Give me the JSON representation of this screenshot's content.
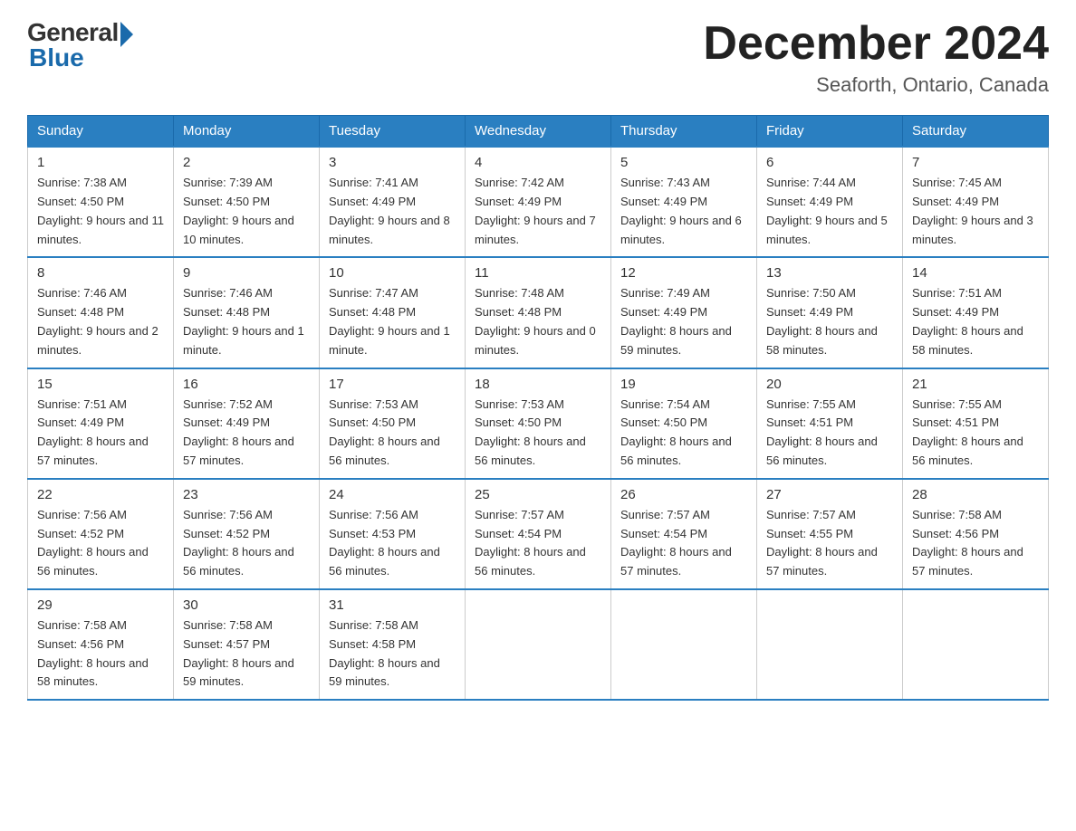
{
  "logo": {
    "general": "General",
    "blue": "Blue"
  },
  "header": {
    "title": "December 2024",
    "subtitle": "Seaforth, Ontario, Canada"
  },
  "days_of_week": [
    "Sunday",
    "Monday",
    "Tuesday",
    "Wednesday",
    "Thursday",
    "Friday",
    "Saturday"
  ],
  "weeks": [
    [
      {
        "day": "1",
        "sunrise": "7:38 AM",
        "sunset": "4:50 PM",
        "daylight": "9 hours and 11 minutes."
      },
      {
        "day": "2",
        "sunrise": "7:39 AM",
        "sunset": "4:50 PM",
        "daylight": "9 hours and 10 minutes."
      },
      {
        "day": "3",
        "sunrise": "7:41 AM",
        "sunset": "4:49 PM",
        "daylight": "9 hours and 8 minutes."
      },
      {
        "day": "4",
        "sunrise": "7:42 AM",
        "sunset": "4:49 PM",
        "daylight": "9 hours and 7 minutes."
      },
      {
        "day": "5",
        "sunrise": "7:43 AM",
        "sunset": "4:49 PM",
        "daylight": "9 hours and 6 minutes."
      },
      {
        "day": "6",
        "sunrise": "7:44 AM",
        "sunset": "4:49 PM",
        "daylight": "9 hours and 5 minutes."
      },
      {
        "day": "7",
        "sunrise": "7:45 AM",
        "sunset": "4:49 PM",
        "daylight": "9 hours and 3 minutes."
      }
    ],
    [
      {
        "day": "8",
        "sunrise": "7:46 AM",
        "sunset": "4:48 PM",
        "daylight": "9 hours and 2 minutes."
      },
      {
        "day": "9",
        "sunrise": "7:46 AM",
        "sunset": "4:48 PM",
        "daylight": "9 hours and 1 minute."
      },
      {
        "day": "10",
        "sunrise": "7:47 AM",
        "sunset": "4:48 PM",
        "daylight": "9 hours and 1 minute."
      },
      {
        "day": "11",
        "sunrise": "7:48 AM",
        "sunset": "4:48 PM",
        "daylight": "9 hours and 0 minutes."
      },
      {
        "day": "12",
        "sunrise": "7:49 AM",
        "sunset": "4:49 PM",
        "daylight": "8 hours and 59 minutes."
      },
      {
        "day": "13",
        "sunrise": "7:50 AM",
        "sunset": "4:49 PM",
        "daylight": "8 hours and 58 minutes."
      },
      {
        "day": "14",
        "sunrise": "7:51 AM",
        "sunset": "4:49 PM",
        "daylight": "8 hours and 58 minutes."
      }
    ],
    [
      {
        "day": "15",
        "sunrise": "7:51 AM",
        "sunset": "4:49 PM",
        "daylight": "8 hours and 57 minutes."
      },
      {
        "day": "16",
        "sunrise": "7:52 AM",
        "sunset": "4:49 PM",
        "daylight": "8 hours and 57 minutes."
      },
      {
        "day": "17",
        "sunrise": "7:53 AM",
        "sunset": "4:50 PM",
        "daylight": "8 hours and 56 minutes."
      },
      {
        "day": "18",
        "sunrise": "7:53 AM",
        "sunset": "4:50 PM",
        "daylight": "8 hours and 56 minutes."
      },
      {
        "day": "19",
        "sunrise": "7:54 AM",
        "sunset": "4:50 PM",
        "daylight": "8 hours and 56 minutes."
      },
      {
        "day": "20",
        "sunrise": "7:55 AM",
        "sunset": "4:51 PM",
        "daylight": "8 hours and 56 minutes."
      },
      {
        "day": "21",
        "sunrise": "7:55 AM",
        "sunset": "4:51 PM",
        "daylight": "8 hours and 56 minutes."
      }
    ],
    [
      {
        "day": "22",
        "sunrise": "7:56 AM",
        "sunset": "4:52 PM",
        "daylight": "8 hours and 56 minutes."
      },
      {
        "day": "23",
        "sunrise": "7:56 AM",
        "sunset": "4:52 PM",
        "daylight": "8 hours and 56 minutes."
      },
      {
        "day": "24",
        "sunrise": "7:56 AM",
        "sunset": "4:53 PM",
        "daylight": "8 hours and 56 minutes."
      },
      {
        "day": "25",
        "sunrise": "7:57 AM",
        "sunset": "4:54 PM",
        "daylight": "8 hours and 56 minutes."
      },
      {
        "day": "26",
        "sunrise": "7:57 AM",
        "sunset": "4:54 PM",
        "daylight": "8 hours and 57 minutes."
      },
      {
        "day": "27",
        "sunrise": "7:57 AM",
        "sunset": "4:55 PM",
        "daylight": "8 hours and 57 minutes."
      },
      {
        "day": "28",
        "sunrise": "7:58 AM",
        "sunset": "4:56 PM",
        "daylight": "8 hours and 57 minutes."
      }
    ],
    [
      {
        "day": "29",
        "sunrise": "7:58 AM",
        "sunset": "4:56 PM",
        "daylight": "8 hours and 58 minutes."
      },
      {
        "day": "30",
        "sunrise": "7:58 AM",
        "sunset": "4:57 PM",
        "daylight": "8 hours and 59 minutes."
      },
      {
        "day": "31",
        "sunrise": "7:58 AM",
        "sunset": "4:58 PM",
        "daylight": "8 hours and 59 minutes."
      },
      null,
      null,
      null,
      null
    ]
  ]
}
